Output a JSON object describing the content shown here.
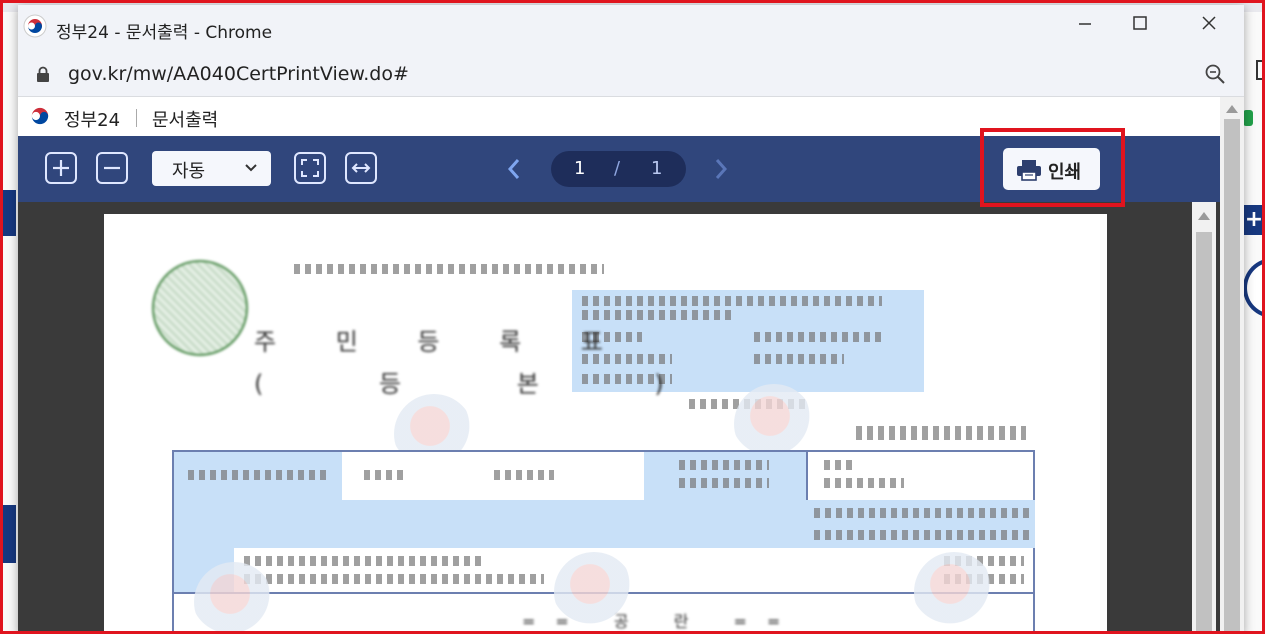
{
  "window": {
    "title": "정부24 - 문서출력 - Chrome",
    "url": "gov.kr/mw/AA040CertPrintView.do#"
  },
  "site": {
    "brand": "정부24",
    "section": "문서출력"
  },
  "toolbar": {
    "zoom_value": "자동",
    "current_page": "1",
    "page_separator": "/",
    "total_pages": "1",
    "print_label": "인쇄"
  },
  "document": {
    "title": "주 민 등 록 표",
    "subtitle": "( 등 본 )",
    "footer": "== 공 란 =="
  },
  "colors": {
    "toolbar_bg": "#30467c",
    "pager_bg": "#1e2d5a",
    "highlight": "#e0141e",
    "document_blue": "#c8e0f8"
  },
  "icons": [
    "zoom-in-icon",
    "zoom-out-icon",
    "fit-page-icon",
    "fit-width-icon",
    "chevron-left-icon",
    "chevron-right-icon",
    "printer-icon",
    "lock-icon",
    "magnifier-icon",
    "minimize-icon",
    "maximize-icon",
    "close-icon"
  ]
}
